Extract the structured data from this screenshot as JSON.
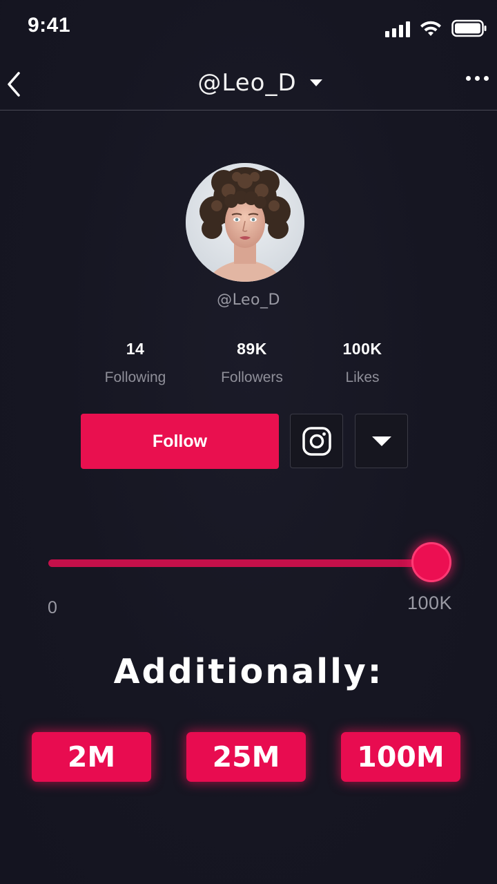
{
  "status_bar": {
    "time": "9:41"
  },
  "header": {
    "title": "@Leo_D"
  },
  "profile": {
    "username": "@Leo_D",
    "stats": [
      {
        "value": "14",
        "label": "Following"
      },
      {
        "value": "89K",
        "label": "Followers"
      },
      {
        "value": "100K",
        "label": "Likes"
      }
    ]
  },
  "actions": {
    "follow_label": "Follow"
  },
  "slider": {
    "min_label": "0",
    "max_label": "100K",
    "value_fraction": 0.95
  },
  "additionally": {
    "title": "Additionally:",
    "options": [
      "2M",
      "25M",
      "100M"
    ]
  },
  "colors": {
    "background": "#161622",
    "accent": "#e9104f",
    "muted_text": "#9a9aa4"
  },
  "icons": {
    "back": "chevron-left-icon",
    "dropdown": "caret-down-icon",
    "more": "more-horizontal-icon",
    "instagram": "instagram-icon",
    "signal": "signal-icon",
    "wifi": "wifi-icon",
    "battery": "battery-icon"
  }
}
